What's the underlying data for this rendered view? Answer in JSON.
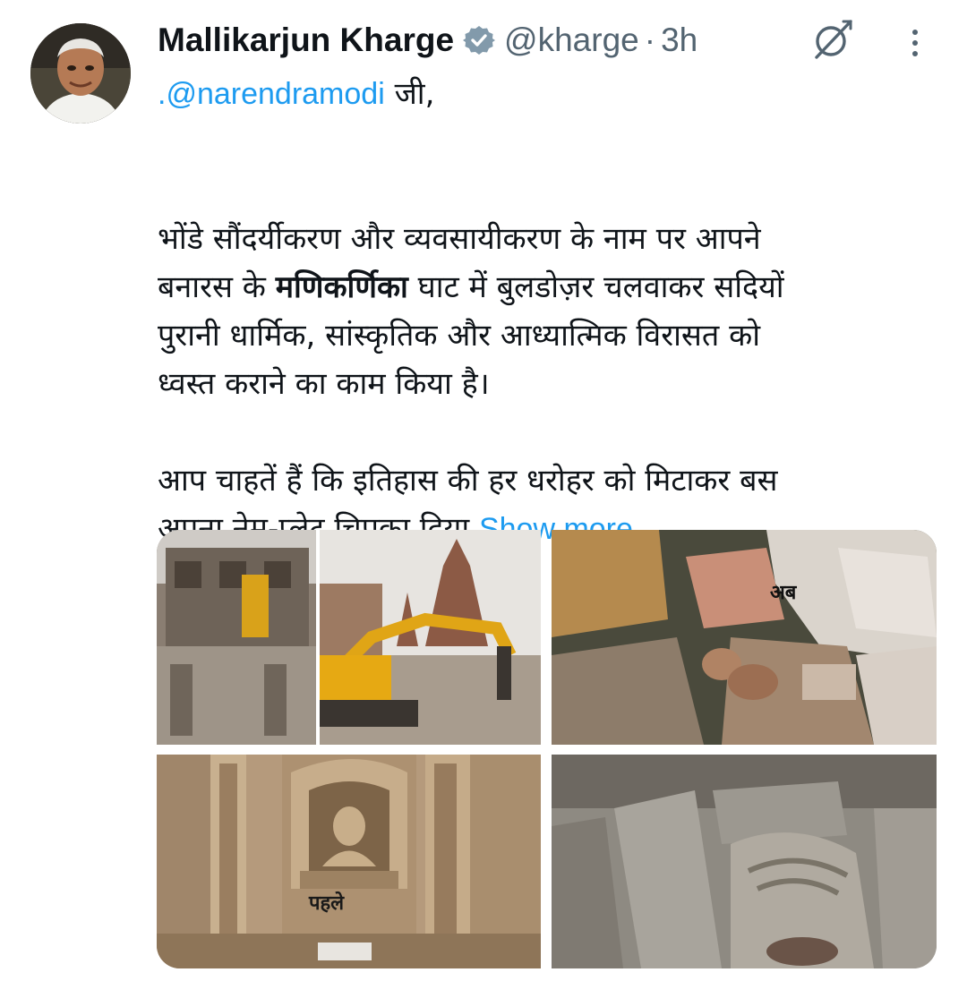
{
  "author": {
    "name": "Mallikarjun Kharge",
    "handle": "@kharge",
    "separator": "·",
    "time": "3h",
    "verified": true,
    "avatar_icon": "profile-photo"
  },
  "icons": {
    "verified": "verified-badge-icon",
    "grok": "grok-icon",
    "more": "more-vertical-icon"
  },
  "tweet": {
    "mention": ".@narendramodi",
    "mention_suffix": " जी,",
    "para1": {
      "line1": "भोंडे सौंदर्यीकरण और व्यवसायीकरण के नाम पर आपने",
      "line2_pre": "बनारस के ",
      "line2_bold": "मणिकर्णिका",
      "line2_post": " घाट में बुलडोज़र चलवाकर सदियों",
      "line3": "पुरानी धार्मिक, सांस्कृतिक और आध्यात्मिक विरासत को",
      "line4": "ध्वस्त कराने का काम किया है।"
    },
    "para2": {
      "line1": "आप चाहतें हैं कि इतिहास की हर धरोहर को मिटाकर बस",
      "line2": "अपना नेम-प्लेट चिपका दिया "
    },
    "show_more": "Show more"
  },
  "media": {
    "labels": {
      "now": "अब",
      "before": "पहले"
    }
  },
  "colors": {
    "accent": "#1d9bf0",
    "secondary_text": "#536471",
    "text": "#0f1419"
  }
}
